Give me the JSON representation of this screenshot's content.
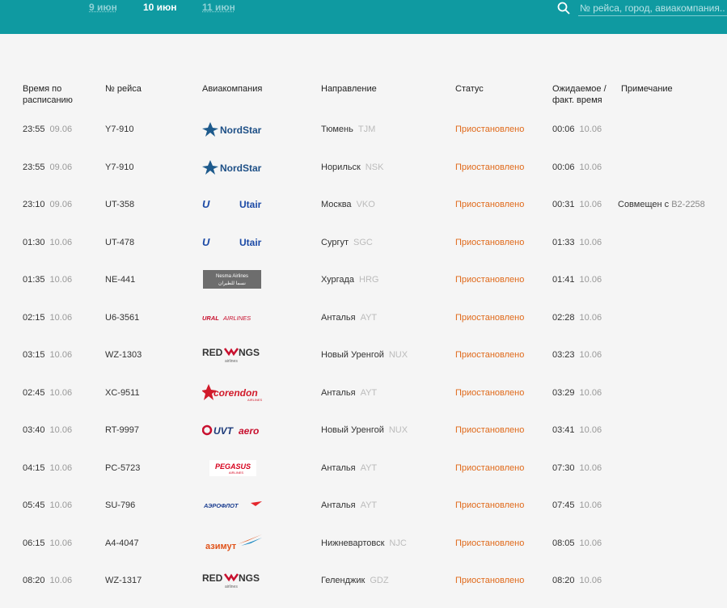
{
  "header": {
    "dates": [
      {
        "label": "9 июн",
        "active": false
      },
      {
        "label": "10 июн",
        "active": true
      },
      {
        "label": "11 июн",
        "active": false
      }
    ],
    "search_placeholder": "№ рейса, город, авиакомпания..."
  },
  "columns": {
    "sched_time": "Время по расписанию",
    "flight_no": "№ рейса",
    "airline": "Авиакомпания",
    "destination": "Направление",
    "status": "Статус",
    "expected_time": "Ожидаемое / факт. время",
    "note": "Примечание"
  },
  "colors": {
    "topbar": "#0f9aa1",
    "status": "#e06a1b"
  },
  "flights": [
    {
      "time": "23:55",
      "date": "09.06",
      "flight": "Y7-910",
      "airline": "NordStar",
      "city": "Тюмень",
      "code": "TJM",
      "status": "Приостановлено",
      "exp_time": "00:06",
      "exp_date": "10.06",
      "note": ""
    },
    {
      "time": "23:55",
      "date": "09.06",
      "flight": "Y7-910",
      "airline": "NordStar",
      "city": "Норильск",
      "code": "NSK",
      "status": "Приостановлено",
      "exp_time": "00:06",
      "exp_date": "10.06",
      "note": ""
    },
    {
      "time": "23:10",
      "date": "09.06",
      "flight": "UT-358",
      "airline": "Utair",
      "city": "Москва",
      "code": "VKO",
      "status": "Приостановлено",
      "exp_time": "00:31",
      "exp_date": "10.06",
      "note": "Совмещен с",
      "note_link": "B2-2258"
    },
    {
      "time": "01:30",
      "date": "10.06",
      "flight": "UT-478",
      "airline": "Utair",
      "city": "Сургут",
      "code": "SGC",
      "status": "Приостановлено",
      "exp_time": "01:33",
      "exp_date": "10.06",
      "note": ""
    },
    {
      "time": "01:35",
      "date": "10.06",
      "flight": "NE-441",
      "airline": "Nesma Airlines",
      "city": "Хургада",
      "code": "HRG",
      "status": "Приостановлено",
      "exp_time": "01:41",
      "exp_date": "10.06",
      "note": ""
    },
    {
      "time": "02:15",
      "date": "10.06",
      "flight": "U6-3561",
      "airline": "URAL AIRLINES",
      "city": "Анталья",
      "code": "AYT",
      "status": "Приостановлено",
      "exp_time": "02:28",
      "exp_date": "10.06",
      "note": ""
    },
    {
      "time": "03:15",
      "date": "10.06",
      "flight": "WZ-1303",
      "airline": "REDWINGS",
      "city": "Новый Уренгой",
      "code": "NUX",
      "status": "Приостановлено",
      "exp_time": "03:23",
      "exp_date": "10.06",
      "note": ""
    },
    {
      "time": "02:45",
      "date": "10.06",
      "flight": "XC-9511",
      "airline": "corendon",
      "city": "Анталья",
      "code": "AYT",
      "status": "Приостановлено",
      "exp_time": "03:29",
      "exp_date": "10.06",
      "note": ""
    },
    {
      "time": "03:40",
      "date": "10.06",
      "flight": "RT-9997",
      "airline": "UVTaero",
      "city": "Новый Уренгой",
      "code": "NUX",
      "status": "Приостановлено",
      "exp_time": "03:41",
      "exp_date": "10.06",
      "note": ""
    },
    {
      "time": "04:15",
      "date": "10.06",
      "flight": "PC-5723",
      "airline": "PEGASUS",
      "city": "Анталья",
      "code": "AYT",
      "status": "Приостановлено",
      "exp_time": "07:30",
      "exp_date": "10.06",
      "note": ""
    },
    {
      "time": "05:45",
      "date": "10.06",
      "flight": "SU-796",
      "airline": "АЭРОФЛОТ",
      "city": "Анталья",
      "code": "AYT",
      "status": "Приостановлено",
      "exp_time": "07:45",
      "exp_date": "10.06",
      "note": ""
    },
    {
      "time": "06:15",
      "date": "10.06",
      "flight": "A4-4047",
      "airline": "азимут",
      "city": "Нижневартовск",
      "code": "NJC",
      "status": "Приостановлено",
      "exp_time": "08:05",
      "exp_date": "10.06",
      "note": ""
    },
    {
      "time": "08:20",
      "date": "10.06",
      "flight": "WZ-1317",
      "airline": "REDWINGS",
      "city": "Геленджик",
      "code": "GDZ",
      "status": "Приостановлено",
      "exp_time": "08:20",
      "exp_date": "10.06",
      "note": ""
    }
  ]
}
